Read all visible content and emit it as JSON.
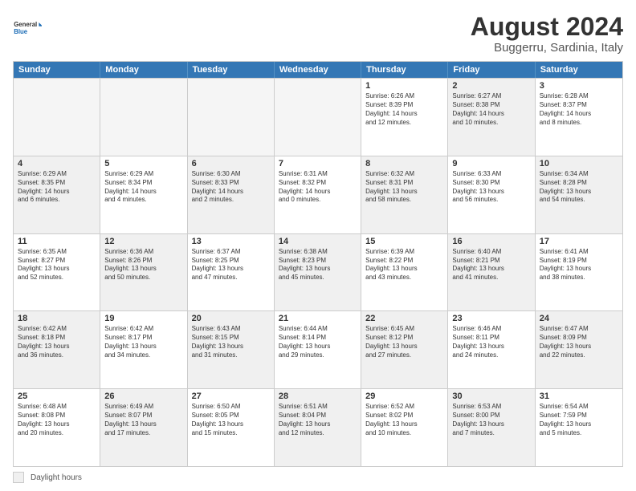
{
  "logo": {
    "text_general": "General",
    "text_blue": "Blue"
  },
  "title": "August 2024",
  "subtitle": "Buggerru, Sardinia, Italy",
  "days_header": [
    "Sunday",
    "Monday",
    "Tuesday",
    "Wednesday",
    "Thursday",
    "Friday",
    "Saturday"
  ],
  "legend_text": "Daylight hours",
  "rows": [
    [
      {
        "day": "",
        "info": "",
        "empty": true
      },
      {
        "day": "",
        "info": "",
        "empty": true
      },
      {
        "day": "",
        "info": "",
        "empty": true
      },
      {
        "day": "",
        "info": "",
        "empty": true
      },
      {
        "day": "1",
        "info": "Sunrise: 6:26 AM\nSunset: 8:39 PM\nDaylight: 14 hours\nand 12 minutes.",
        "shaded": false
      },
      {
        "day": "2",
        "info": "Sunrise: 6:27 AM\nSunset: 8:38 PM\nDaylight: 14 hours\nand 10 minutes.",
        "shaded": true
      },
      {
        "day": "3",
        "info": "Sunrise: 6:28 AM\nSunset: 8:37 PM\nDaylight: 14 hours\nand 8 minutes.",
        "shaded": false
      }
    ],
    [
      {
        "day": "4",
        "info": "Sunrise: 6:29 AM\nSunset: 8:35 PM\nDaylight: 14 hours\nand 6 minutes.",
        "shaded": true
      },
      {
        "day": "5",
        "info": "Sunrise: 6:29 AM\nSunset: 8:34 PM\nDaylight: 14 hours\nand 4 minutes.",
        "shaded": false
      },
      {
        "day": "6",
        "info": "Sunrise: 6:30 AM\nSunset: 8:33 PM\nDaylight: 14 hours\nand 2 minutes.",
        "shaded": true
      },
      {
        "day": "7",
        "info": "Sunrise: 6:31 AM\nSunset: 8:32 PM\nDaylight: 14 hours\nand 0 minutes.",
        "shaded": false
      },
      {
        "day": "8",
        "info": "Sunrise: 6:32 AM\nSunset: 8:31 PM\nDaylight: 13 hours\nand 58 minutes.",
        "shaded": true
      },
      {
        "day": "9",
        "info": "Sunrise: 6:33 AM\nSunset: 8:30 PM\nDaylight: 13 hours\nand 56 minutes.",
        "shaded": false
      },
      {
        "day": "10",
        "info": "Sunrise: 6:34 AM\nSunset: 8:28 PM\nDaylight: 13 hours\nand 54 minutes.",
        "shaded": true
      }
    ],
    [
      {
        "day": "11",
        "info": "Sunrise: 6:35 AM\nSunset: 8:27 PM\nDaylight: 13 hours\nand 52 minutes.",
        "shaded": false
      },
      {
        "day": "12",
        "info": "Sunrise: 6:36 AM\nSunset: 8:26 PM\nDaylight: 13 hours\nand 50 minutes.",
        "shaded": true
      },
      {
        "day": "13",
        "info": "Sunrise: 6:37 AM\nSunset: 8:25 PM\nDaylight: 13 hours\nand 47 minutes.",
        "shaded": false
      },
      {
        "day": "14",
        "info": "Sunrise: 6:38 AM\nSunset: 8:23 PM\nDaylight: 13 hours\nand 45 minutes.",
        "shaded": true
      },
      {
        "day": "15",
        "info": "Sunrise: 6:39 AM\nSunset: 8:22 PM\nDaylight: 13 hours\nand 43 minutes.",
        "shaded": false
      },
      {
        "day": "16",
        "info": "Sunrise: 6:40 AM\nSunset: 8:21 PM\nDaylight: 13 hours\nand 41 minutes.",
        "shaded": true
      },
      {
        "day": "17",
        "info": "Sunrise: 6:41 AM\nSunset: 8:19 PM\nDaylight: 13 hours\nand 38 minutes.",
        "shaded": false
      }
    ],
    [
      {
        "day": "18",
        "info": "Sunrise: 6:42 AM\nSunset: 8:18 PM\nDaylight: 13 hours\nand 36 minutes.",
        "shaded": true
      },
      {
        "day": "19",
        "info": "Sunrise: 6:42 AM\nSunset: 8:17 PM\nDaylight: 13 hours\nand 34 minutes.",
        "shaded": false
      },
      {
        "day": "20",
        "info": "Sunrise: 6:43 AM\nSunset: 8:15 PM\nDaylight: 13 hours\nand 31 minutes.",
        "shaded": true
      },
      {
        "day": "21",
        "info": "Sunrise: 6:44 AM\nSunset: 8:14 PM\nDaylight: 13 hours\nand 29 minutes.",
        "shaded": false
      },
      {
        "day": "22",
        "info": "Sunrise: 6:45 AM\nSunset: 8:12 PM\nDaylight: 13 hours\nand 27 minutes.",
        "shaded": true
      },
      {
        "day": "23",
        "info": "Sunrise: 6:46 AM\nSunset: 8:11 PM\nDaylight: 13 hours\nand 24 minutes.",
        "shaded": false
      },
      {
        "day": "24",
        "info": "Sunrise: 6:47 AM\nSunset: 8:09 PM\nDaylight: 13 hours\nand 22 minutes.",
        "shaded": true
      }
    ],
    [
      {
        "day": "25",
        "info": "Sunrise: 6:48 AM\nSunset: 8:08 PM\nDaylight: 13 hours\nand 20 minutes.",
        "shaded": false
      },
      {
        "day": "26",
        "info": "Sunrise: 6:49 AM\nSunset: 8:07 PM\nDaylight: 13 hours\nand 17 minutes.",
        "shaded": true
      },
      {
        "day": "27",
        "info": "Sunrise: 6:50 AM\nSunset: 8:05 PM\nDaylight: 13 hours\nand 15 minutes.",
        "shaded": false
      },
      {
        "day": "28",
        "info": "Sunrise: 6:51 AM\nSunset: 8:04 PM\nDaylight: 13 hours\nand 12 minutes.",
        "shaded": true
      },
      {
        "day": "29",
        "info": "Sunrise: 6:52 AM\nSunset: 8:02 PM\nDaylight: 13 hours\nand 10 minutes.",
        "shaded": false
      },
      {
        "day": "30",
        "info": "Sunrise: 6:53 AM\nSunset: 8:00 PM\nDaylight: 13 hours\nand 7 minutes.",
        "shaded": true
      },
      {
        "day": "31",
        "info": "Sunrise: 6:54 AM\nSunset: 7:59 PM\nDaylight: 13 hours\nand 5 minutes.",
        "shaded": false
      }
    ]
  ]
}
